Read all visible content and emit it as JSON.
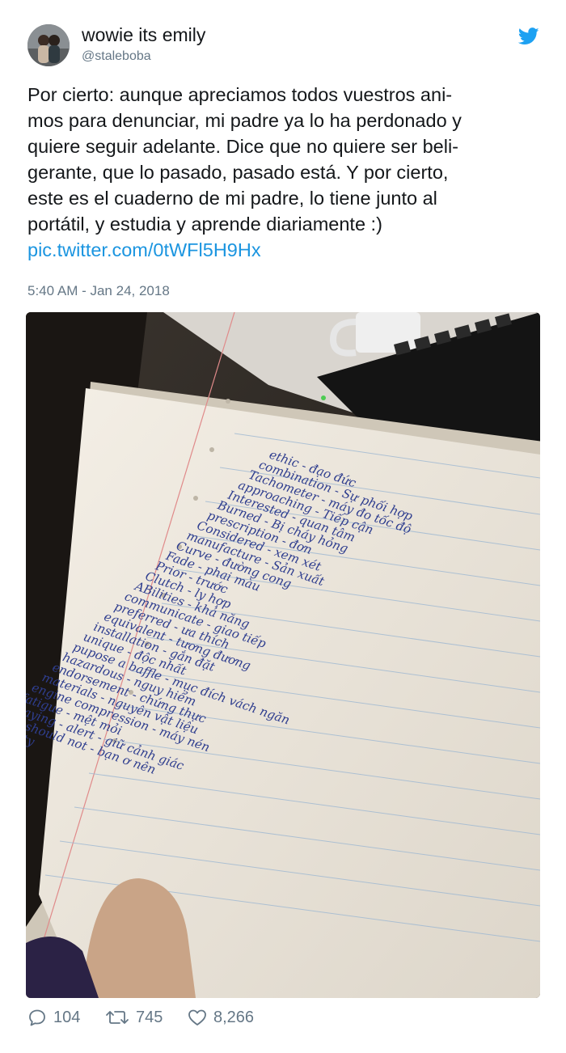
{
  "user": {
    "name": "wowie its emily",
    "handle": "@staleboba"
  },
  "tweet": {
    "lines": [
      "Por cierto: aunque apreciamos todos vuestros ani-",
      "mos para denunciar, mi padre ya lo ha perdonado y",
      "quiere seguir adelante. Dice que no quiere ser beli-",
      "gerante, que lo pasado, pasado está. Y por cierto,",
      "este es el cuaderno de mi padre, lo tiene junto al",
      "portátil, y estudia y aprende diariamente :)"
    ],
    "link": "pic.twitter.com/0tWFl5H9Hx",
    "timestamp": "5:40 AM - Jan 24, 2018"
  },
  "photo": {
    "notebook_lines": [
      "ethic - đạo đức",
      "combination - Sự phối hợp",
      "Tachometer - máy đo tốc độ",
      "approaching - Tiếp cận",
      "Interested - quan tâm",
      "Burned - Bị cháy hỏng",
      "prescription - đơn",
      "Considered - xem xét",
      "manufacture - Sản xuất",
      "Curve - đường cong",
      "Fade - phai màu",
      "Prior - trước",
      "Clutch - ly hợp",
      "ABilities - khả năng",
      "communicate - giao tiếp",
      "preferred - ưa thích",
      "equivalent - tương đương",
      "installation - gắn đặt",
      "unique - độc nhất",
      "pupose a baffle - mục đích vách ngăn",
      "hazardous - nguy hiểm",
      "endorsement - chứng thực",
      "materials - nguyên vật liệu",
      "engine compression - máy nén",
      "fatigue - mệt mỏi",
      "Staying - alert - giữ cảnh giác",
      "you should not - bạn ơ nên",
      "penalty"
    ]
  },
  "actions": {
    "replies": "104",
    "retweets": "745",
    "likes": "8,266"
  },
  "colors": {
    "link": "#1b95e0",
    "secondary_text": "#657786",
    "twitter_blue": "#1da1f2"
  }
}
